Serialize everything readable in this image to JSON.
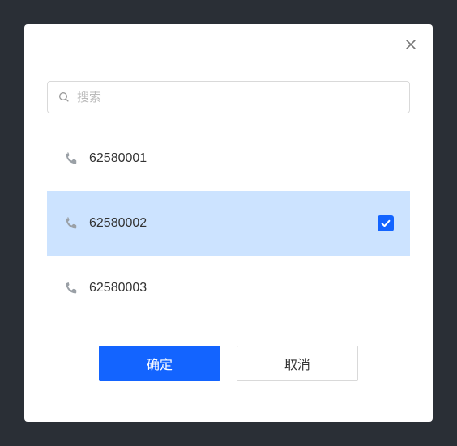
{
  "modal": {
    "title": "",
    "search": {
      "placeholder": "搜索"
    },
    "items": [
      {
        "number": "62580001",
        "selected": false
      },
      {
        "number": "62580002",
        "selected": true
      },
      {
        "number": "62580003",
        "selected": false
      }
    ],
    "actions": {
      "confirm": "确定",
      "cancel": "取消"
    }
  }
}
